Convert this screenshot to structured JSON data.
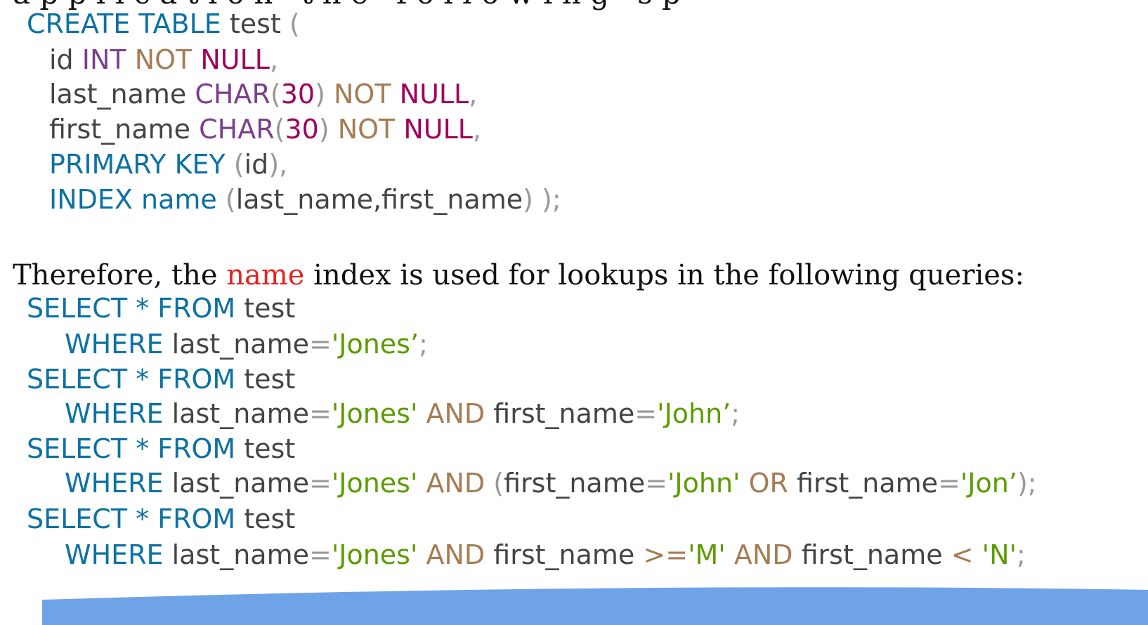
{
  "create_table": {
    "line1": {
      "kw": "CREATE TABLE",
      "name": " test",
      "paren": " ("
    },
    "line2": {
      "col": "id",
      "type": " INT",
      "not": " NOT",
      "null": " NULL",
      "comma": ","
    },
    "line3": {
      "col": "last_name",
      "type": " CHAR",
      "open": "(",
      "num": "30",
      "close": ")",
      "not": " NOT",
      "null": " NULL",
      "comma": ","
    },
    "line4": {
      "col": "first_name",
      "type": " CHAR",
      "open": "(",
      "num": "30",
      "close": ")",
      "not": " NOT",
      "null": " NULL",
      "comma": ","
    },
    "line5": {
      "kw": "PRIMARY KEY",
      "open": " (",
      "col": "id",
      "close": "),"
    },
    "line6": {
      "kw": "INDEX",
      "name": " name",
      "open": " (",
      "cols": "last_name,first_name",
      "close": ") );"
    }
  },
  "prose": {
    "before": "Therefore, the ",
    "highlight": "name",
    "after": " index is used for lookups in the following queries:"
  },
  "queries": [
    {
      "select": {
        "kw1": "SELECT",
        "star": " *",
        "kw2": " FROM",
        "table": " test"
      },
      "where": {
        "kw": "WHERE",
        "col1": " last_name",
        "eq1": "=",
        "val1": "'Jones’",
        "end": ";"
      }
    },
    {
      "select": {
        "kw1": "SELECT",
        "star": " *",
        "kw2": " FROM",
        "table": " test"
      },
      "where": {
        "kw": "WHERE",
        "col1": " last_name",
        "eq1": "=",
        "val1": "'Jones'",
        "and": " AND",
        "col2": " first_name",
        "eq2": "=",
        "val2": "'John’",
        "end": ";"
      }
    },
    {
      "select": {
        "kw1": "SELECT",
        "star": " *",
        "kw2": " FROM",
        "table": " test"
      },
      "where": {
        "kw": "WHERE",
        "col1": " last_name",
        "eq1": "=",
        "val1": "'Jones'",
        "and": " AND",
        "open": " (",
        "col2": "first_name",
        "eq2": "=",
        "val2": "'John'",
        "or": " OR",
        "col3": " first_name",
        "eq3": "=",
        "val3": "'Jon’",
        "end": ");"
      }
    },
    {
      "select": {
        "kw1": "SELECT",
        "star": " *",
        "kw2": " FROM",
        "table": " test"
      },
      "where": {
        "kw": "WHERE",
        "col1": " last_name",
        "eq1": "=",
        "val1": "'Jones'",
        "and": " AND",
        "col2": " first_name",
        "op2": " >=",
        "val2": "'M'",
        "and2": " AND",
        "col3": " first_name",
        "op3": " <",
        "val3": " 'N'",
        "end": ";"
      }
    }
  ],
  "colors": {
    "keyword": "#0c71a3",
    "type": "#7b3f8c",
    "modifier": "#a67c52",
    "null": "#a0005c",
    "string": "#5b9c00",
    "highlight": "#e4231f",
    "accent_band": "#6fa3e8"
  }
}
